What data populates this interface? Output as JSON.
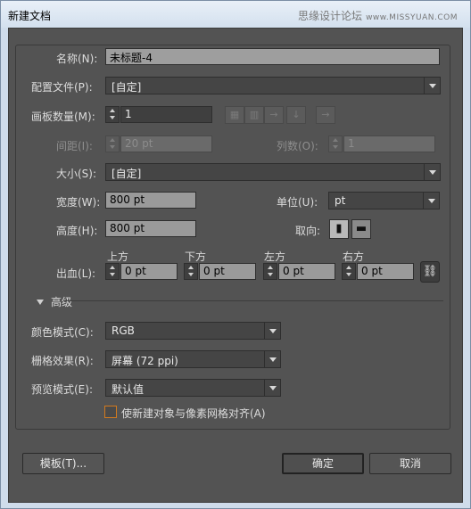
{
  "window": {
    "title": "新建文档"
  },
  "watermark": {
    "text": "思缘设计论坛",
    "small": "www.MISSYUAN.COM"
  },
  "form": {
    "name_label": "名称(N):",
    "name_value": "未标题-4",
    "profile_label": "配置文件(P):",
    "profile_value": "[自定]",
    "artboards_label": "画板数量(M):",
    "artboards_value": "1",
    "spacing_label": "间距(I):",
    "spacing_value": "20 pt",
    "columns_label": "列数(O):",
    "columns_value": "1",
    "size_label": "大小(S):",
    "size_value": "[自定]",
    "width_label": "宽度(W):",
    "width_value": "800 pt",
    "units_label": "单位(U):",
    "units_value": "pt",
    "height_label": "高度(H):",
    "height_value": "800 pt",
    "orientation_label": "取向:",
    "bleed_label": "出血(L):",
    "bleed": {
      "top_label": "上方",
      "top_value": "0 pt",
      "bottom_label": "下方",
      "bottom_value": "0 pt",
      "left_label": "左方",
      "left_value": "0 pt",
      "right_label": "右方",
      "right_value": "0 pt"
    },
    "advanced_label": "高级",
    "color_mode_label": "颜色模式(C):",
    "color_mode_value": "RGB",
    "raster_label": "栅格效果(R):",
    "raster_value": "屏幕 (72 ppi)",
    "preview_label": "预览模式(E):",
    "preview_value": "默认值",
    "align_pixel_label": "使新建对象与像素网格对齐(A)"
  },
  "buttons": {
    "templates": "模板(T)...",
    "ok": "确定",
    "cancel": "取消"
  },
  "icons": {
    "grid_by_row": "grid-by-row-icon",
    "grid_by_column": "grid-by-column-icon",
    "arrange_row": "arrange-by-row-icon",
    "arrange_column": "arrange-by-column-icon",
    "right_to_left": "right-to-left-icon",
    "portrait": "portrait-icon",
    "landscape": "landscape-icon",
    "link": "link-icon"
  },
  "colors": {
    "panel": "#535353",
    "checkbox_border": "#d27a1e"
  }
}
